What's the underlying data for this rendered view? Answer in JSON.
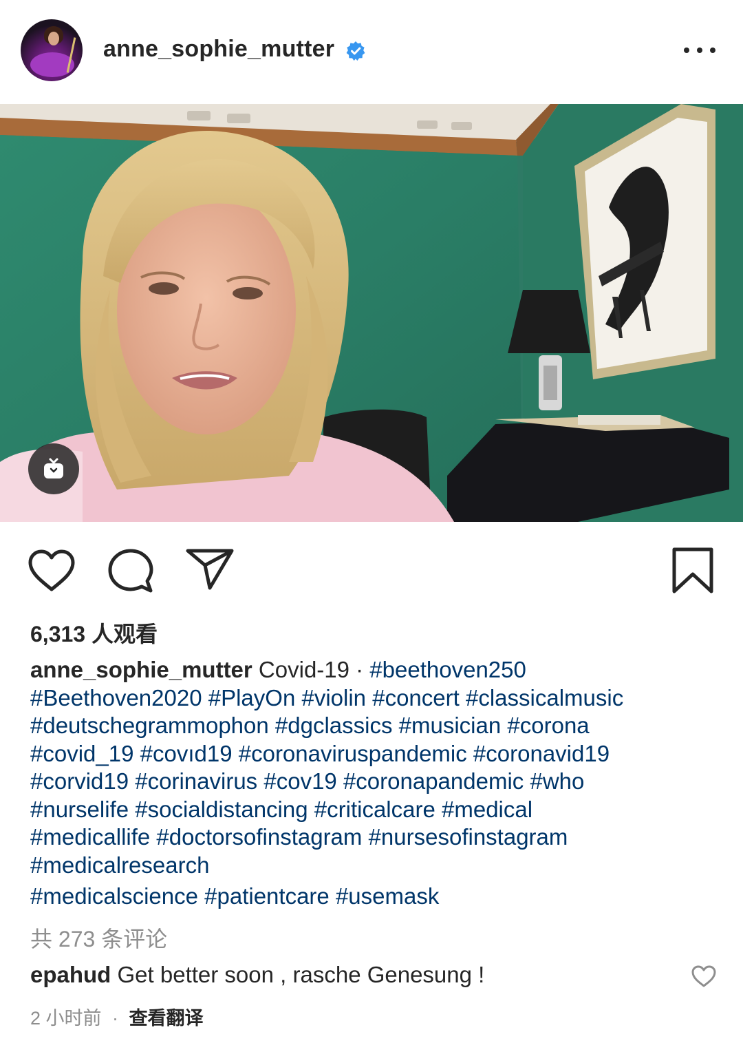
{
  "post": {
    "username": "anne_sophie_mutter",
    "verified": true,
    "accent_verified_color": "#3897f0",
    "more_icon": "more-options-icon"
  },
  "video": {
    "igtv_icon": "igtv-icon"
  },
  "actions": {
    "like_icon": "heart-icon",
    "comment_icon": "comment-icon",
    "share_icon": "paper-plane-icon",
    "save_icon": "bookmark-icon"
  },
  "views_text": "6,313 人观看",
  "caption": {
    "username": "anne_sophie_mutter",
    "text": "Covid-19 · ",
    "lines": [
      [
        "#beethoven250"
      ],
      [
        "#Beethoven2020",
        "#PlayOn",
        "#violin",
        "#concert",
        "#classicalmusic"
      ],
      [
        "#deutschegrammophon",
        "#dgclassics",
        "#musician",
        "#corona"
      ],
      [
        "#covid_19",
        "#covıd19",
        "#coronaviruspandemic",
        "#coronavid19"
      ],
      [
        "#corvid19",
        "#corinavirus",
        "#cov19",
        "#coronapandemic",
        "#who"
      ],
      [
        "#nurselife",
        "#socialdistancing",
        "#criticalcare",
        "#medical"
      ],
      [
        "#medicallife",
        "#doctorsofinstagram",
        "#nursesofinstagram"
      ],
      [
        "#medicalresearch"
      ],
      [
        "#medicalscience",
        "#patientcare",
        "#usemask"
      ]
    ],
    "hashtag_color": "#003569"
  },
  "comments_count_text": "共 273 条评论",
  "comment": {
    "username": "epahud",
    "text": "Get better soon , rasche Genesung !",
    "like_icon": "heart-icon"
  },
  "comment_meta": {
    "time": "2 小时前",
    "separator": "·",
    "translate": "查看翻译"
  }
}
